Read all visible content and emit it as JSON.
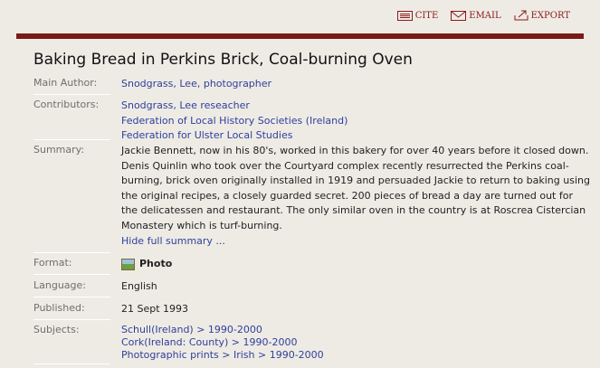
{
  "toolbar": {
    "cite": "CITE",
    "email": "EMAIL",
    "export": "EXPORT"
  },
  "record": {
    "title": "Baking Bread in Perkins Brick, Coal-burning Oven",
    "main_author_label": "Main Author:",
    "main_author": "Snodgrass, Lee, photographer",
    "contributors_label": "Contributors:",
    "contributors": [
      "Snodgrass, Lee reseacher",
      "Federation of Local History Societies (Ireland)",
      "Federation for Ulster Local Studies"
    ],
    "summary_label": "Summary:",
    "summary": "Jackie Bennett, now in his 80's, worked in this bakery for over 40 years before it closed down. Denis Quinlin who took over the Courtyard complex recently resurrected the Perkins coal-burning, brick oven originally installed in 1919 and persuaded Jackie to return to baking using the original recipes, a closely guarded secret. 200 pieces of bread a day are turned out for the delicatessen and restaurant. The only similar oven in the country is at Roscrea Cistercian Monastery which is turf-burning.",
    "hide_summary": "Hide full summary ...",
    "format_label": "Format:",
    "format": "Photo",
    "language_label": "Language:",
    "language": "English",
    "published_label": "Published:",
    "published": "21 Sept 1993",
    "subjects_label": "Subjects:",
    "subjects": [
      "Schull(Ireland) > 1990-2000",
      "Cork(Ireland: County) > 1990-2000",
      "Photographic prints > Irish > 1990-2000"
    ]
  }
}
